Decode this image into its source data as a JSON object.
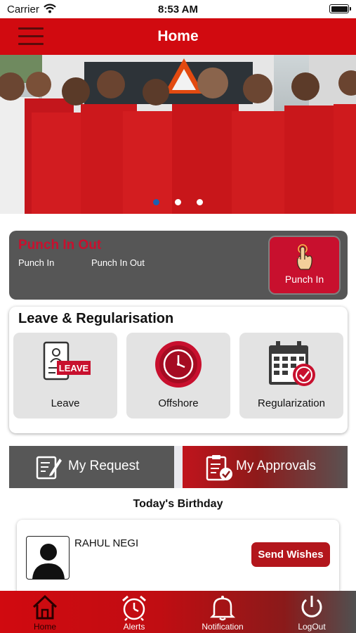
{
  "status_bar": {
    "carrier": "Carrier",
    "time": "8:53 AM"
  },
  "header": {
    "title": "Home",
    "menu_icon": "hamburger-menu-icon"
  },
  "banner": {
    "slides": 3,
    "active_slide": 1
  },
  "punch": {
    "title": "Punch In Out",
    "labels": [
      "Punch In",
      "Punch In Out"
    ],
    "button_label": "Punch In",
    "button_icon": "tap-hand-icon"
  },
  "leave": {
    "title": "Leave & Regularisation",
    "tiles": [
      {
        "label": "Leave",
        "icon": "leave-document-icon",
        "badge": "LEAVE"
      },
      {
        "label": "Offshore",
        "icon": "clock-icon"
      },
      {
        "label": "Regularization",
        "icon": "calendar-check-icon"
      }
    ]
  },
  "tabs": [
    {
      "label": "My Request",
      "icon": "edit-document-icon"
    },
    {
      "label": "My Approvals",
      "icon": "clipboard-check-icon"
    }
  ],
  "birthday": {
    "heading": "Today's Birthday",
    "name": "RAHUL NEGI",
    "button_label": "Send Wishes"
  },
  "bottom_nav": [
    {
      "label": "Home",
      "icon": "home-icon",
      "active": true
    },
    {
      "label": "Alerts",
      "icon": "alarm-clock-icon"
    },
    {
      "label": "Notification",
      "icon": "bell-icon"
    },
    {
      "label": "LogOut",
      "icon": "power-icon"
    }
  ],
  "colors": {
    "brand_red": "#d10a10",
    "card_gray": "#565656",
    "accent_red": "#c8102e"
  }
}
